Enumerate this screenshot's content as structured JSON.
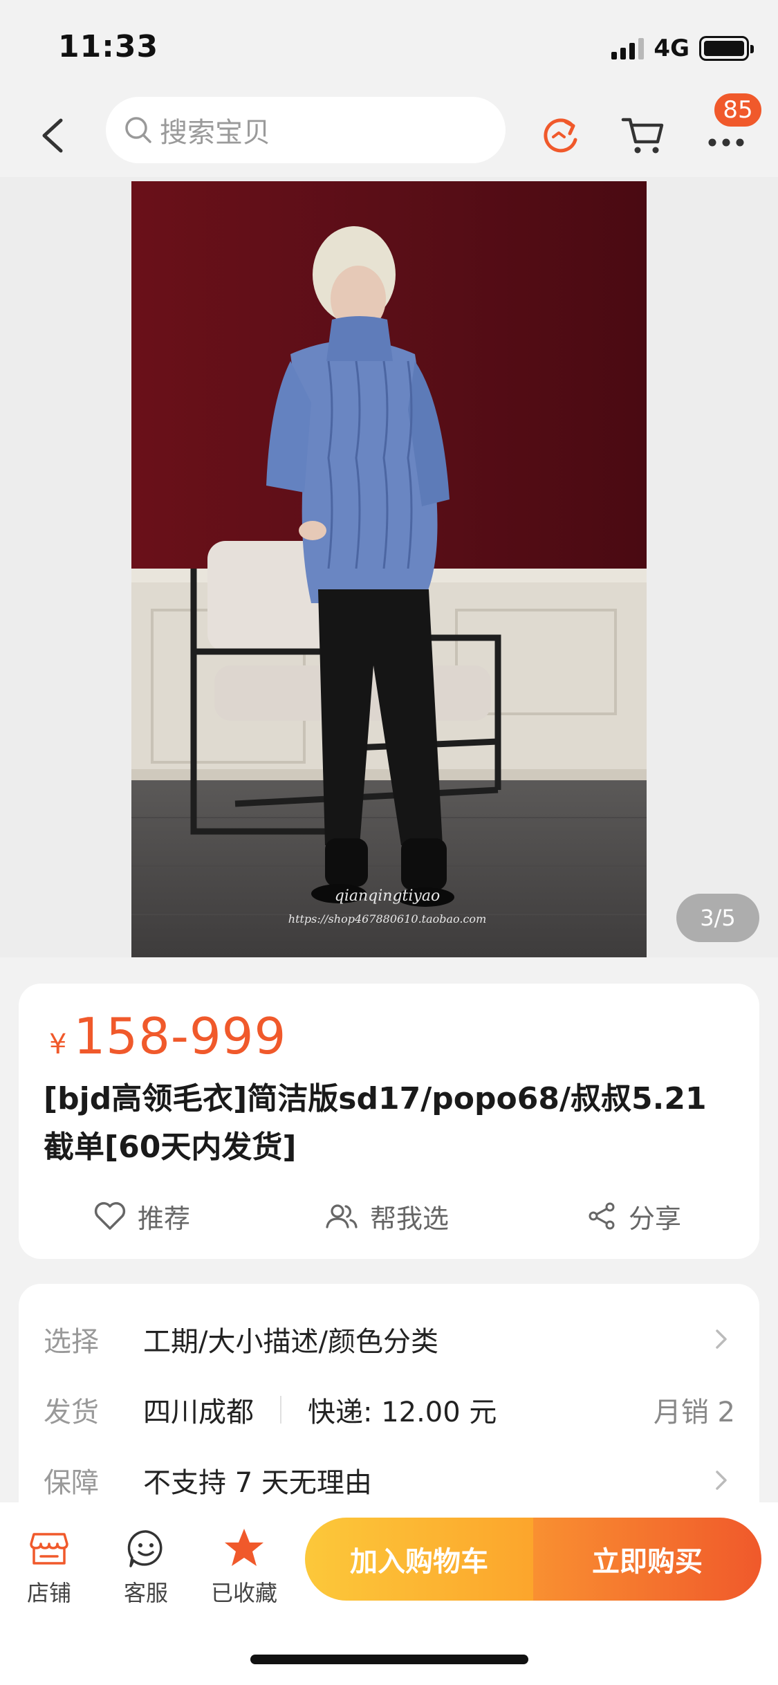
{
  "status_bar": {
    "time": "11:33",
    "network": "4G"
  },
  "nav": {
    "search_placeholder": "搜索宝贝",
    "badge_count": "85"
  },
  "gallery": {
    "indicator": "3/5",
    "watermark_line1": "qianqingtiyao",
    "watermark_line2": "https://shop467880610.taobao.com"
  },
  "product": {
    "currency": "¥",
    "price": "158-999",
    "title": "[bjd高领毛衣]简洁版sd17/popo68/叔叔5.21截单[60天内发货]"
  },
  "actions": {
    "recommend": "推荐",
    "help_choose": "帮我选",
    "share": "分享"
  },
  "specs": {
    "select_label": "选择",
    "select_value": "工期/大小描述/颜色分类",
    "ship_label": "发货",
    "ship_from": "四川成都",
    "ship_fee": "快递: 12.00 元",
    "monthly_sales": "月销 2",
    "guarantee_label": "保障",
    "guarantee_value": "不支持 7 天无理由"
  },
  "bottom": {
    "store": "店铺",
    "service": "客服",
    "favorited": "已收藏",
    "add_to_cart": "加入购物车",
    "buy_now": "立即购买"
  },
  "colors": {
    "accent": "#f0592b",
    "cart_button": "#fcb634",
    "buy_button": "#f2672d",
    "photo_wall": "#5a1018"
  }
}
